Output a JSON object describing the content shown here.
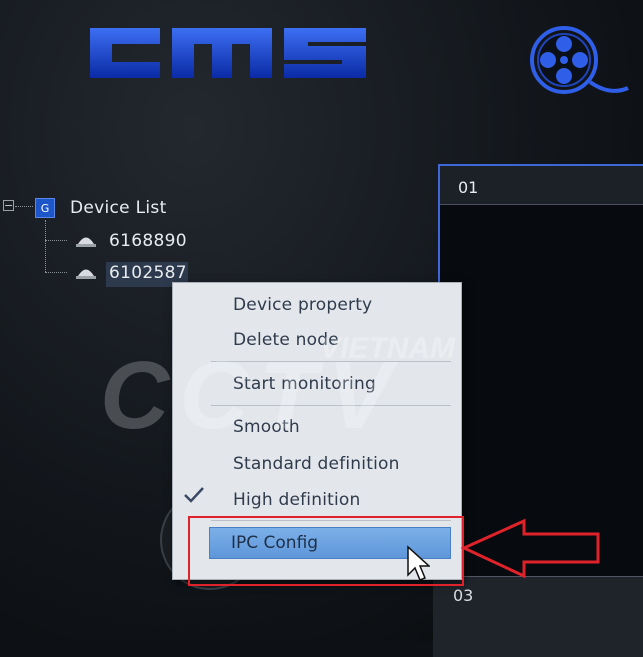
{
  "app": {
    "logo_text": "CMS"
  },
  "device_tree": {
    "root_toggle": "−",
    "root_icon_letter": "G",
    "root_label": "Device List",
    "devices": [
      {
        "id": "6168890",
        "selected": false
      },
      {
        "id": "6102587",
        "selected": true
      }
    ]
  },
  "context_menu": {
    "items": [
      {
        "label": "Device property"
      },
      {
        "label": "Delete node"
      },
      {
        "label": "Start monitoring"
      },
      {
        "label": "Smooth"
      },
      {
        "label": "Standard definition"
      },
      {
        "label": "High definition",
        "checked": true
      },
      {
        "label": "IPC Config",
        "highlighted": true
      }
    ]
  },
  "video_panels": [
    {
      "label": "01"
    },
    {
      "label": "03"
    }
  ],
  "watermark": {
    "top": "VIETNAM",
    "main": "CCTV"
  },
  "annotation": {
    "highlight_color": "#e0232b",
    "arrow_color": "#e0232b"
  },
  "colors": {
    "accent": "#1d56c9",
    "panel_border": "#3e68d8",
    "menu_bg": "#e3e7ec",
    "selection": "#6aa2e2"
  }
}
